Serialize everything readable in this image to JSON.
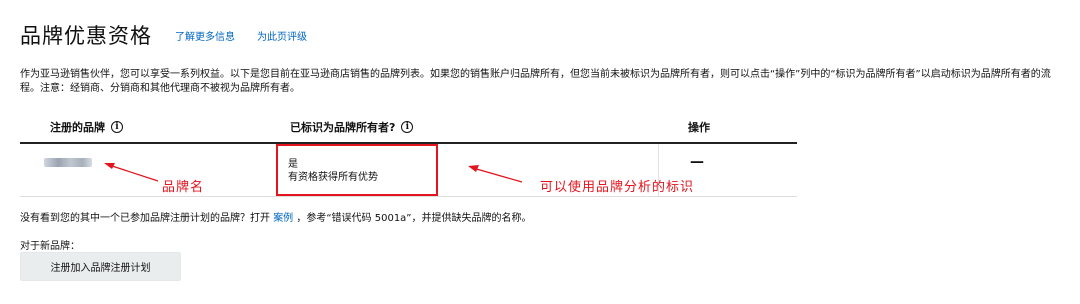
{
  "page": {
    "title": "品牌优惠资格",
    "learn_more_link": "了解更多信息",
    "rate_page_link": "为此页评级",
    "description": "作为亚马逊销售伙伴，您可以享受一系列权益。以下是您目前在亚马逊商店销售的品牌列表。如果您的销售账户归品牌所有，但您当前未被标识为品牌所有者，则可以点击“操作”列中的“标识为品牌所有者”以启动标识为品牌所有者的流程。注意：经销商、分销商和其他代理商不被视为品牌所有者。"
  },
  "table": {
    "headers": {
      "brand": "注册的品牌",
      "owner": "已标识为品牌所有者?",
      "action": "操作"
    },
    "rows": [
      {
        "owner_status": "是",
        "owner_detail": "有资格获得所有优势",
        "action": "—"
      }
    ]
  },
  "annotations": {
    "brand_name": "品牌名",
    "analytics_label": "可以使用品牌分析的标识",
    "color": "#e3141d"
  },
  "footer": {
    "missing_prefix": "没有看到您的其中一个已参加品牌注册计划的品牌？打开",
    "case_link": "案例",
    "missing_suffix": "，参考“错误代码 5001a”，并提供缺失品牌的名称。",
    "new_brand_label": "对于新品牌：",
    "enroll_button": "注册加入品牌注册计划"
  },
  "icons": {
    "info": "info-circle-icon",
    "arrow": "red-arrow"
  }
}
